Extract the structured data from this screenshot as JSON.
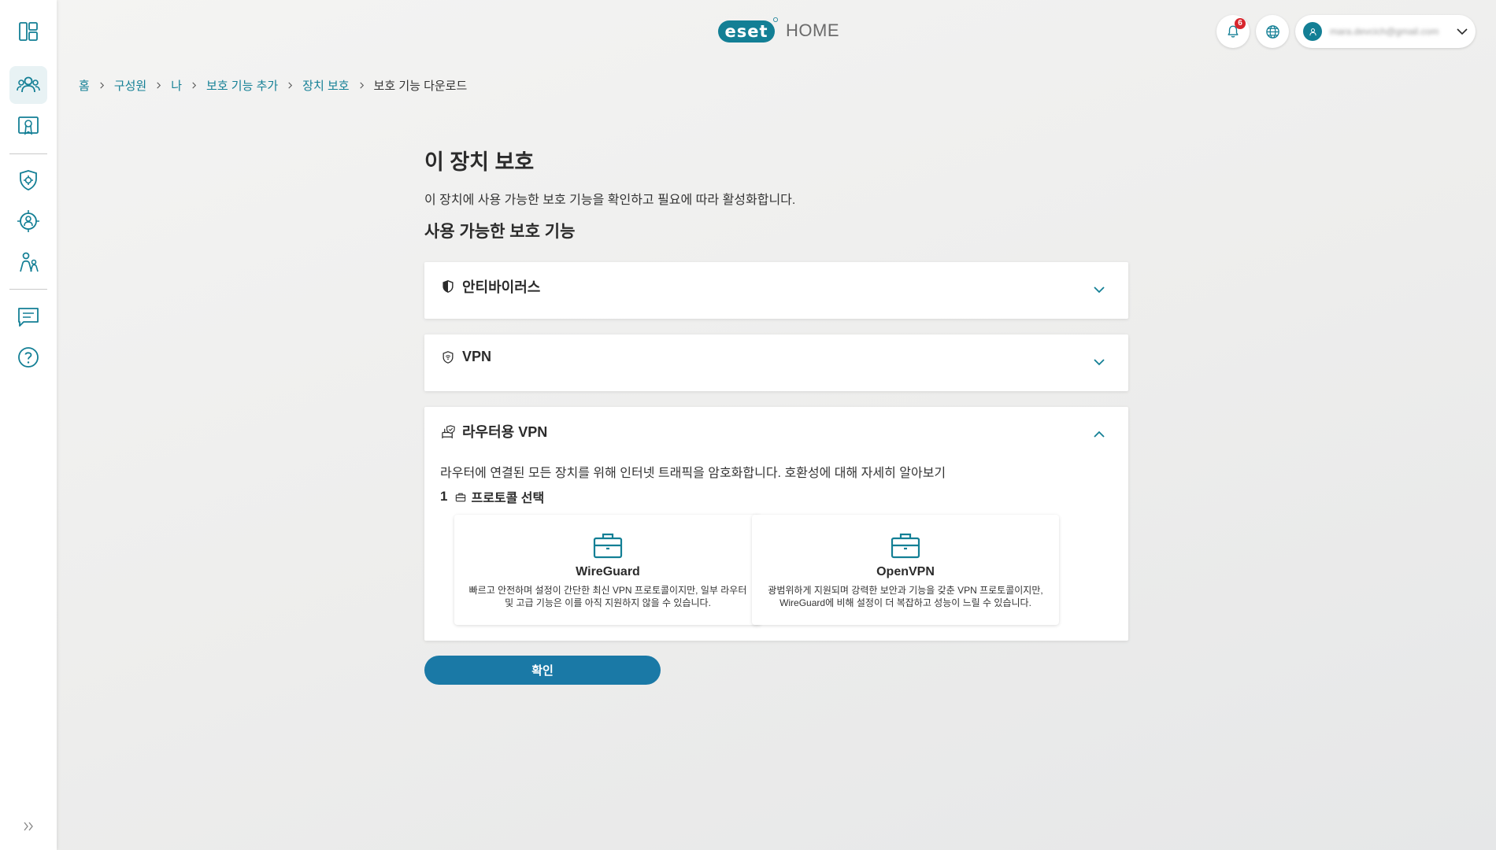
{
  "sidebar": {
    "items": [
      {
        "name": "dashboard",
        "icon": "dashboard-icon"
      },
      {
        "name": "members",
        "icon": "people-icon",
        "active": true
      },
      {
        "name": "licenses",
        "icon": "license-certificate-icon"
      },
      {
        "name": "security",
        "icon": "security-gear-icon"
      },
      {
        "name": "anti-theft",
        "icon": "anti-theft-icon"
      },
      {
        "name": "parental",
        "icon": "family-icon"
      },
      {
        "name": "messages",
        "icon": "message-icon"
      },
      {
        "name": "help",
        "icon": "help-icon"
      }
    ],
    "expand_icon": "double-chevron-right-icon"
  },
  "header": {
    "logo_text": "eset",
    "logo_suffix": "HOME",
    "notifications_count": "6",
    "account_email": "mara.devcich@gmail.com"
  },
  "breadcrumb": {
    "items": [
      "홈",
      "구성원",
      "나",
      "보호 기능 추가",
      "장치 보호"
    ],
    "current": "보호 기능 다운로드"
  },
  "page": {
    "title": "이 장치 보호",
    "description": "이 장치에 사용 가능한 보호 기능을 확인하고 필요에 따라 활성화합니다.",
    "section_title": "사용 가능한 보호 기능"
  },
  "features": {
    "antivirus": {
      "title": "안티바이러스",
      "expanded": false
    },
    "vpn": {
      "title": "VPN",
      "expanded": false
    },
    "router_vpn": {
      "title": "라우터용 VPN",
      "expanded": true,
      "description": "라우터에 연결된 모든 장치를 위해 인터넷 트래픽을 암호화합니다. 호환성에 대해 자세히 알아보기",
      "step_number": "1",
      "step_label": "프로토콜 선택",
      "protocols": [
        {
          "name": "WireGuard",
          "description": "빠르고 안전하며 설정이 간단한 최신 VPN 프로토콜이지만, 일부 라우터 및 고급 기능은 이를 아직 지원하지 않을 수 있습니다."
        },
        {
          "name": "OpenVPN",
          "description": "광범위하게 지원되며 강력한 보안과 기능을 갖춘 VPN 프로토콜이지만, WireGuard에 비해 설정이 더 복잡하고 성능이 느릴 수 있습니다."
        }
      ]
    }
  },
  "actions": {
    "confirm_label": "확인"
  },
  "colors": {
    "accent": "#137f95",
    "primary_button": "#1a79a6",
    "notification_badge": "#d8262d"
  }
}
